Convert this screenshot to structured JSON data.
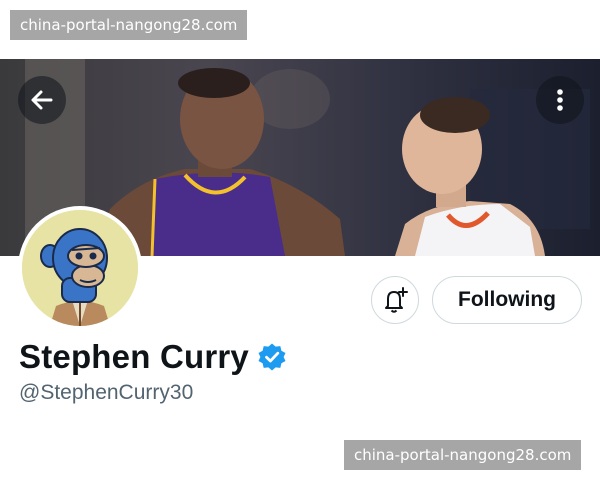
{
  "watermarks": {
    "top": "china-portal-nangong28.com",
    "bottom": "china-portal-nangong28.com"
  },
  "header": {
    "back_icon": "arrow-left-icon",
    "more_icon": "more-vertical-icon"
  },
  "profile": {
    "display_name": "Stephen Curry",
    "verified_icon": "verified-badge-icon",
    "handle": "@StephenCurry30",
    "avatar": "bored-ape-avatar"
  },
  "actions": {
    "notify_icon": "bell-plus-icon",
    "follow_label": "Following"
  },
  "colors": {
    "verified": "#1d9bf0",
    "text_primary": "#0f1419",
    "text_secondary": "#536471",
    "button_border": "#cfd9de",
    "jersey_lakers": "#4a2c8a",
    "avatar_background": "#e7e3a4"
  }
}
